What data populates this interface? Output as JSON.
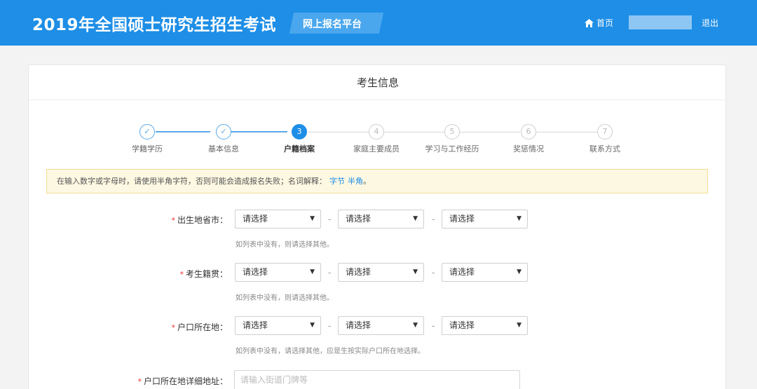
{
  "header": {
    "title": "2019年全国硕士研究生招生考试",
    "platform": "网上报名平台",
    "home_label": "首页",
    "logout_label": "退出"
  },
  "panel": {
    "title": "考生信息"
  },
  "steps": [
    {
      "num": "✓",
      "label": "学籍学历",
      "state": "done"
    },
    {
      "num": "✓",
      "label": "基本信息",
      "state": "done"
    },
    {
      "num": "3",
      "label": "户籍档案",
      "state": "active"
    },
    {
      "num": "4",
      "label": "家庭主要成员",
      "state": "pending"
    },
    {
      "num": "5",
      "label": "学习与工作经历",
      "state": "pending"
    },
    {
      "num": "6",
      "label": "奖惩情况",
      "state": "pending"
    },
    {
      "num": "7",
      "label": "联系方式",
      "state": "pending"
    }
  ],
  "notice": {
    "text": "在输入数字或字母时，请使用半角字符，否则可能会造成报名失败；名词解释：",
    "link1": "字节",
    "link2": "半角",
    "tail": "。"
  },
  "form": {
    "birthplace": {
      "label": "出生地省市：",
      "hint": "如列表中没有，则请选择其他。"
    },
    "native_place": {
      "label": "考生籍贯：",
      "hint": "如列表中没有，则请选择其他。"
    },
    "hukou": {
      "label": "户口所在地：",
      "hint": "如列表中没有，请选择其他，应是生按实际户口所在地选择。"
    },
    "hukou_address": {
      "label": "户口所在地详细地址：",
      "placeholder": "请输入街道门牌等"
    },
    "select_placeholder": "请选择",
    "separator": "-"
  },
  "colors": {
    "brand": "#1e8ee6",
    "required": "#e33333"
  }
}
